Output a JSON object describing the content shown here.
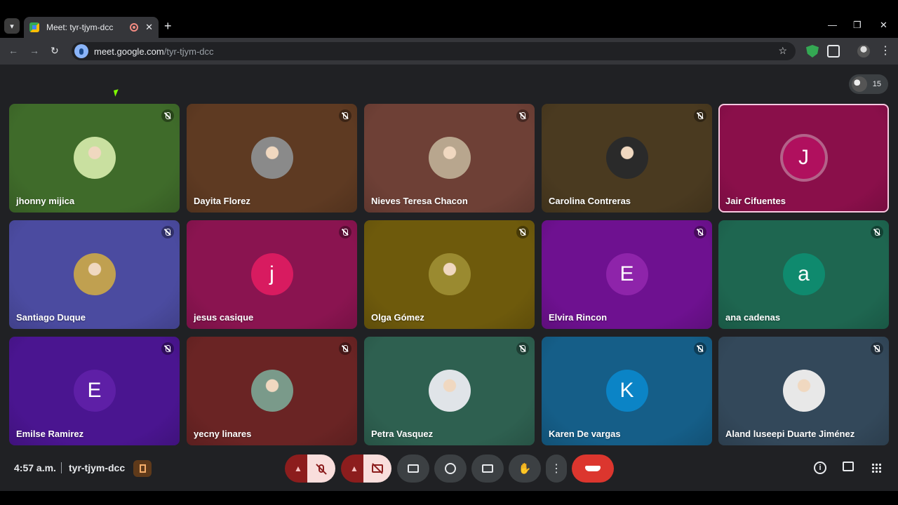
{
  "browser": {
    "tab_title": "Meet: tyr-tjym-dcc",
    "tab_close": "✕",
    "new_tab": "+",
    "url_host": "meet.google.com",
    "url_path": "/tyr-tjym-dcc",
    "window_controls": {
      "minimize": "—",
      "restore": "❐",
      "close": "✕"
    }
  },
  "meet": {
    "participant_count": "15",
    "time": "4:57 a.m.",
    "meeting_code": "tyr-tjym-dcc",
    "participants": [
      {
        "name": "jhonny mijica",
        "bg": "#3f6b2a",
        "avatar": "photo",
        "avatar_color": "#c9e0a0",
        "muted": true
      },
      {
        "name": "Dayita Florez",
        "bg": "#5e3a22",
        "avatar": "photo",
        "avatar_color": "#8a8a8a",
        "muted": true
      },
      {
        "name": "Nieves Teresa Chacon",
        "bg": "#6e4036",
        "avatar": "photo",
        "avatar_color": "#b8a68e",
        "muted": true
      },
      {
        "name": "Carolina Contreras",
        "bg": "#4a3a20",
        "avatar": "photo",
        "avatar_color": "#2a2a2a",
        "muted": true
      },
      {
        "name": "Jair Cifuentes",
        "bg": "#8a0f4a",
        "avatar": "letter",
        "letter": "J",
        "avatar_color": "#b0105e",
        "muted": false
      },
      {
        "name": "Santiago Duque",
        "bg": "#4b4ba0",
        "avatar": "photo",
        "avatar_color": "#c0a050",
        "muted": true
      },
      {
        "name": "jesus casique",
        "bg": "#8a1450",
        "avatar": "letter",
        "letter": "j",
        "avatar_color": "#d81b60",
        "muted": true
      },
      {
        "name": "Olga Gómez",
        "bg": "#6e5a0c",
        "avatar": "photo",
        "avatar_color": "#9a8a30",
        "muted": true
      },
      {
        "name": "Elvira Rincon",
        "bg": "#6e1190",
        "avatar": "letter",
        "letter": "E",
        "avatar_color": "#8e24aa",
        "muted": true
      },
      {
        "name": "ana cadenas",
        "bg": "#1e6650",
        "avatar": "letter",
        "letter": "a",
        "avatar_color": "#0f8a6e",
        "muted": true
      },
      {
        "name": "Emilse Ramirez",
        "bg": "#4a1590",
        "avatar": "letter",
        "letter": "E",
        "avatar_color": "#5e1fa6",
        "muted": true
      },
      {
        "name": "yecny linares",
        "bg": "#6a2424",
        "avatar": "photo",
        "avatar_color": "#7a9a8a",
        "muted": true
      },
      {
        "name": "Petra Vasquez",
        "bg": "#2e6050",
        "avatar": "photo",
        "avatar_color": "#e0e4e8",
        "muted": true
      },
      {
        "name": "Karen De vargas",
        "bg": "#155e88",
        "avatar": "letter",
        "letter": "K",
        "avatar_color": "#0b84c6",
        "muted": true
      },
      {
        "name": "Aland luseepi Duarte Jiménez",
        "bg": "#33485a",
        "avatar": "photo",
        "avatar_color": "#e8e8e8",
        "muted": true
      }
    ]
  },
  "colors": {
    "meet_bg": "#202124",
    "control_red": "#8c1d1d",
    "control_red_light": "#f9dedc",
    "hangup": "#dc362e"
  }
}
